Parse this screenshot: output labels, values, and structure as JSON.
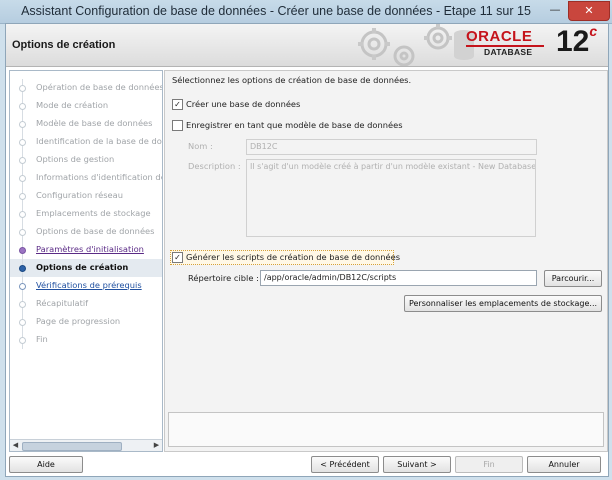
{
  "window": {
    "title": "Assistant Configuration de base de données - Créer une base de données - Etape 11 sur 15",
    "minimize_glyph": "—",
    "close_glyph": "✕"
  },
  "header": {
    "page_title": "Options de création",
    "oracle_word": "ORACLE",
    "database_word": "DATABASE",
    "version": "12",
    "version_suffix": "c"
  },
  "sidebar": {
    "items": [
      {
        "label": "Opération de base de données",
        "state": "done"
      },
      {
        "label": "Mode de création",
        "state": "done"
      },
      {
        "label": "Modèle de base de données",
        "state": "done"
      },
      {
        "label": "Identification de la base de don",
        "state": "done"
      },
      {
        "label": "Options de gestion",
        "state": "done"
      },
      {
        "label": "Informations d'identification de",
        "state": "done"
      },
      {
        "label": "Configuration réseau",
        "state": "done"
      },
      {
        "label": "Emplacements de stockage",
        "state": "done"
      },
      {
        "label": "Options de base de données",
        "state": "done"
      },
      {
        "label": "Paramètres d'initialisation",
        "state": "visited"
      },
      {
        "label": "Options de création",
        "state": "current"
      },
      {
        "label": "Vérifications de prérequis",
        "state": "next"
      },
      {
        "label": "Récapitulatif",
        "state": "todo"
      },
      {
        "label": "Page de progression",
        "state": "todo"
      },
      {
        "label": "Fin",
        "state": "todo"
      }
    ]
  },
  "main": {
    "intro": "Sélectionnez les options de création de base de données.",
    "create_db": {
      "label": "Créer une base de données",
      "checked": true
    },
    "save_template": {
      "label": "Enregistrer en tant que modèle de base de données",
      "checked": false
    },
    "name_label": "Nom :",
    "name_value": "DB12C",
    "description_label": "Description :",
    "description_value": "Il s'agit d'un modèle créé à partir d'un modèle existant - New Database.",
    "generate_scripts": {
      "label": "Générer les scripts de création de base de données",
      "checked": true
    },
    "target_dir_label": "Répertoire cible :",
    "target_dir_value": "/app/oracle/admin/DB12C/scripts",
    "browse_label": "Parcourir...",
    "customize_label": "Personnaliser les emplacements de stockage..."
  },
  "footer": {
    "help": "Aide",
    "previous": "< Précédent",
    "next": "Suivant >",
    "finish": "Fin",
    "cancel": "Annuler"
  },
  "colors": {
    "oracle_red": "#c5131b",
    "visited_link": "#5a2a86",
    "next_link": "#2050a0",
    "current_step_bg": "#e4eaf0"
  }
}
